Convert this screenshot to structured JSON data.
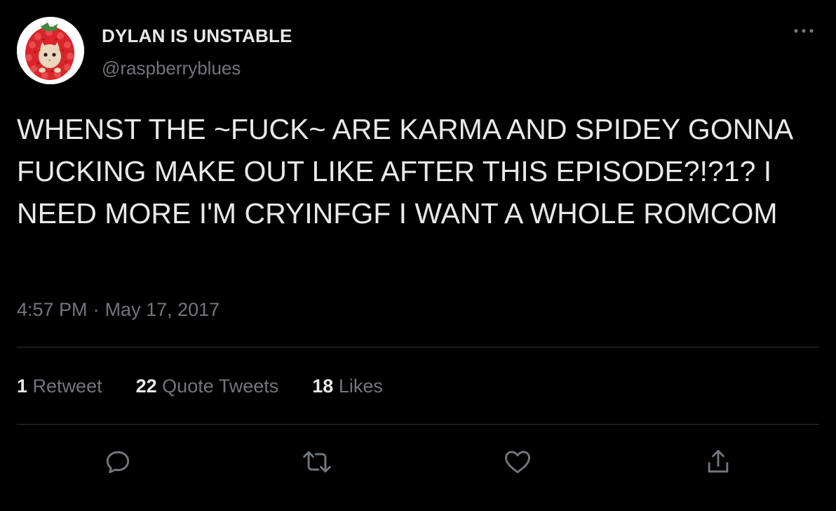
{
  "user": {
    "display_name": "DYLAN IS UNSTABLE",
    "handle": "@raspberryblues"
  },
  "tweet": {
    "text": "WHENST THE ~FUCK~ ARE KARMA AND SPIDEY GONNA FUCKING MAKE OUT LIKE AFTER THIS EPISODE?!?1? I NEED MORE I'M CRYINFGF I WANT A WHOLE ROMCOM",
    "time": "4:57 PM",
    "separator": "·",
    "date": "May 17, 2017"
  },
  "stats": {
    "retweets": {
      "count": "1",
      "label": "Retweet"
    },
    "quotes": {
      "count": "22",
      "label": "Quote Tweets"
    },
    "likes": {
      "count": "18",
      "label": "Likes"
    }
  },
  "icons": {
    "more": "more-horizontal-icon",
    "reply": "reply-icon",
    "retweet": "retweet-icon",
    "like": "heart-icon",
    "share": "share-icon"
  },
  "colors": {
    "background": "#000000",
    "primary_text": "#e7e9ea",
    "secondary_text": "#71767b",
    "divider": "#2f3336",
    "avatar_berry": "#d9252b"
  }
}
